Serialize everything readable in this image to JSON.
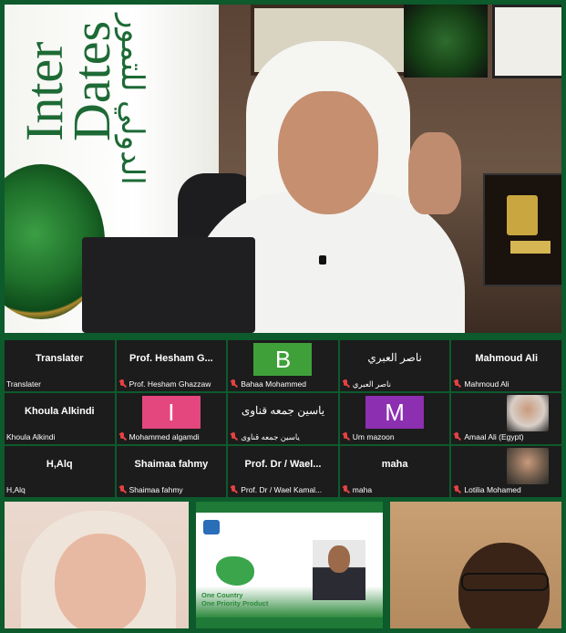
{
  "main_video": {
    "banner_en_line1": "Inter",
    "banner_en_line2": "Dates",
    "banner_ar": "الدولي للتمور"
  },
  "participants": [
    {
      "display": "Translater",
      "name": "Translater",
      "muted": false,
      "kind": "text"
    },
    {
      "display": "Prof. Hesham G...",
      "name": "Prof. Hesham Ghazzaw",
      "muted": true,
      "kind": "text"
    },
    {
      "display": "B",
      "name": "Bahaa Mohammed",
      "muted": true,
      "kind": "avatar",
      "color": "#3fa03a"
    },
    {
      "display": "ناصر العبري",
      "name": "ناصر العبري",
      "muted": true,
      "kind": "text-ar"
    },
    {
      "display": "Mahmoud Ali",
      "name": "Mahmoud Ali",
      "muted": true,
      "kind": "text"
    },
    {
      "display": "Khoula Alkindi",
      "name": "Khoula Alkindi",
      "muted": false,
      "kind": "text"
    },
    {
      "display": "I",
      "name": "Mohammed algamdi",
      "muted": true,
      "kind": "avatar",
      "color": "#e4477d"
    },
    {
      "display": "ياسين جمعه قناوى",
      "name": "ياسين جمعه قناوى",
      "muted": true,
      "kind": "text-ar"
    },
    {
      "display": "M",
      "name": "Um mazoon",
      "muted": true,
      "kind": "avatar",
      "color": "#8d2fb1"
    },
    {
      "display": "",
      "name": "Amaal Ali (Egypt)",
      "muted": true,
      "kind": "photo",
      "color": "#d9cfc8"
    },
    {
      "display": "H,Alq",
      "name": "H,Alq",
      "muted": false,
      "kind": "text"
    },
    {
      "display": "Shaimaa fahmy",
      "name": "Shaimaa fahmy",
      "muted": true,
      "kind": "text"
    },
    {
      "display": "Prof. Dr / Wael...",
      "name": "Prof. Dr / Wael Kamal...",
      "muted": true,
      "kind": "text"
    },
    {
      "display": "maha",
      "name": "maha",
      "muted": true,
      "kind": "text"
    },
    {
      "display": "",
      "name": "Lotilia Mohamed",
      "muted": true,
      "kind": "photo",
      "color": "#6d5a4a"
    }
  ],
  "slide": {
    "line1": "One Country",
    "line2": "One Priority Product"
  }
}
